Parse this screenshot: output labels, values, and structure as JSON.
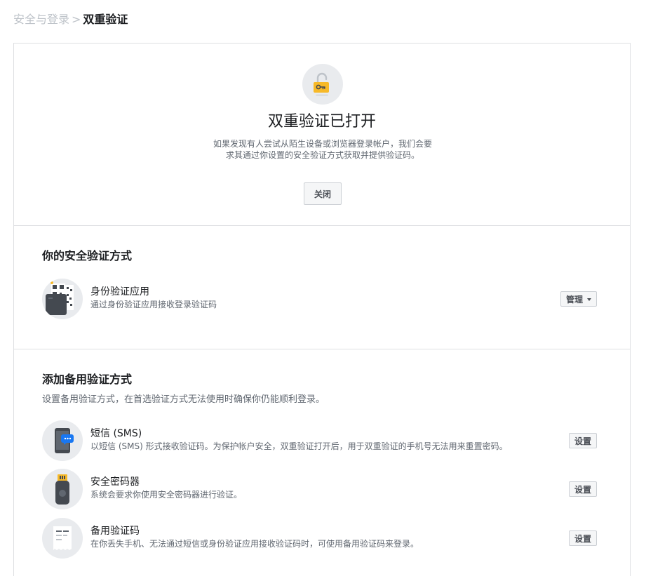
{
  "breadcrumb": {
    "parent": "安全与登录",
    "separator": ">",
    "current": "双重验证"
  },
  "status": {
    "icon": "unlocked-padlock-icon",
    "title": "双重验证已打开",
    "description": "如果发现有人尝试从陌生设备或浏览器登录帐户，我们会要求其通过你设置的安全验证方式获取并提供验证码。",
    "close_label": "关闭"
  },
  "methods": {
    "title": "你的安全验证方式",
    "items": [
      {
        "icon": "qr-code-phone-icon",
        "title": "身份验证应用",
        "description": "通过身份验证应用接收登录验证码",
        "button_label": "管理"
      }
    ]
  },
  "backup": {
    "title": "添加备用验证方式",
    "subtitle": "设置备用验证方式，在首选验证方式无法使用时确保你仍能顺利登录。",
    "items": [
      {
        "icon": "phone-message-icon",
        "title": "短信 (SMS)",
        "description": "以短信 (SMS) 形式接收验证码。为保护帐户安全，双重验证打开后，用于双重验证的手机号无法用来重置密码。",
        "button_label": "设置"
      },
      {
        "icon": "security-key-icon",
        "title": "安全密码器",
        "description": "系统会要求你使用安全密码器进行验证。",
        "button_label": "设置"
      },
      {
        "icon": "backup-codes-icon",
        "title": "备用验证码",
        "description": "在你丢失手机、无法通过短信或身份验证应用接收验证码时，可使用备用验证码来登录。",
        "button_label": "设置"
      }
    ]
  },
  "colors": {
    "accent_yellow": "#f7b928",
    "icon_dark": "#444950",
    "icon_blue": "#1877f2"
  }
}
